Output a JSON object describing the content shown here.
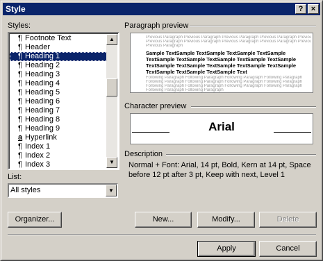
{
  "window": {
    "title": "Style",
    "help_label": "?",
    "close_label": "×"
  },
  "styles": {
    "label": "Styles:",
    "items": [
      {
        "glyph": "¶",
        "label": "Footnote Text"
      },
      {
        "glyph": "¶",
        "label": "Header"
      },
      {
        "glyph": "¶",
        "label": "Heading 1"
      },
      {
        "glyph": "¶",
        "label": "Heading 2"
      },
      {
        "glyph": "¶",
        "label": "Heading 3"
      },
      {
        "glyph": "¶",
        "label": "Heading 4"
      },
      {
        "glyph": "¶",
        "label": "Heading 5"
      },
      {
        "glyph": "¶",
        "label": "Heading 6"
      },
      {
        "glyph": "¶",
        "label": "Heading 7"
      },
      {
        "glyph": "¶",
        "label": "Heading 8"
      },
      {
        "glyph": "¶",
        "label": "Heading 9"
      },
      {
        "glyph": "a",
        "label": "Hyperlink"
      },
      {
        "glyph": "¶",
        "label": "Index 1"
      },
      {
        "glyph": "¶",
        "label": "Index 2"
      },
      {
        "glyph": "¶",
        "label": "Index 3"
      }
    ],
    "selected": "Heading 1"
  },
  "list": {
    "label": "List:",
    "value": "All styles"
  },
  "paragraph_preview": {
    "label": "Paragraph preview",
    "previous_lines": [
      "Previous Paragraph Previous Paragraph Previous Paragraph Previous Paragraph Previous Paragraph",
      "Previous Paragraph Previous Paragraph Previous Paragraph Previous Paragraph Previous Paragraph",
      "Previous Paragraph"
    ],
    "sample_lines": [
      "Sample TextSample TextSample TextSample TextSample",
      "TextSample TextSample TextSample TextSample TextSample",
      "TextSample TextSample TextSample TextSample TextSample",
      "TextSample TextSample TextSample Text"
    ],
    "following_lines": [
      "Following Paragraph Following Paragraph Following Paragraph Following Paragraph",
      "Following Paragraph Following Paragraph Following Paragraph Following Paragraph",
      "Following Paragraph Following Paragraph Following Paragraph Following Paragraph",
      "Following Paragraph Following Paragraph"
    ]
  },
  "character_preview": {
    "label": "Character preview",
    "font_name": "Arial"
  },
  "description": {
    "label": "Description",
    "text": "Normal + Font: Arial, 14 pt, Bold, Kern at 14 pt, Space before 12 pt  after 3 pt, Keep with next, Level 1"
  },
  "buttons": {
    "organizer": "Organizer...",
    "new": "New...",
    "modify": "Modify...",
    "delete": "Delete",
    "apply": "Apply",
    "cancel": "Cancel"
  },
  "colors": {
    "titlebar": "#0a246a",
    "face": "#d4d0c8",
    "selection": "#0a246a"
  },
  "icons": {
    "scroll_up": "triangle-up-icon",
    "scroll_down": "triangle-down-icon",
    "dropdown": "triangle-down-icon"
  }
}
